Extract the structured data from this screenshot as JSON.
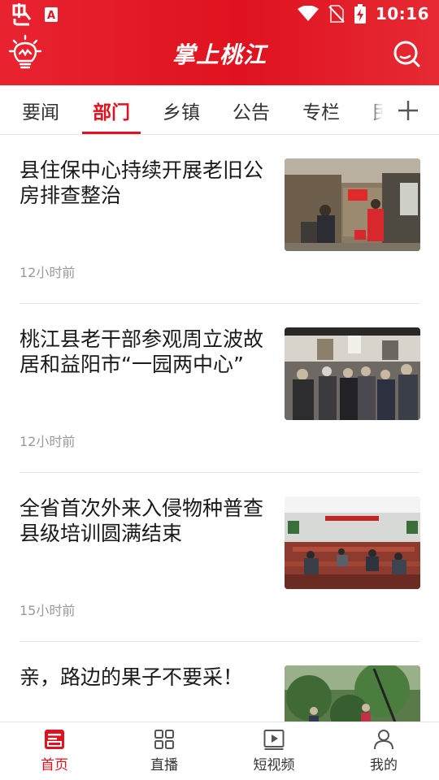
{
  "status_bar": {
    "time": "10:16"
  },
  "header": {
    "title": "掌上桃江",
    "left_icon": "lightbulb-icon",
    "right_icon": "search-icon"
  },
  "tabs": [
    {
      "label": "要闻",
      "active": false
    },
    {
      "label": "部门",
      "active": true
    },
    {
      "label": "乡镇",
      "active": false
    },
    {
      "label": "公告",
      "active": false
    },
    {
      "label": "专栏",
      "active": false
    },
    {
      "label": "民",
      "active": false
    }
  ],
  "add_tab_icon": "plus-icon",
  "news": [
    {
      "title": "县住保中心持续开展老旧公房排查整治",
      "time": "12小时前"
    },
    {
      "title": "桃江县老干部参观周立波故居和益阳市“一园两中心”",
      "time": "12小时前"
    },
    {
      "title": "全省首次外来入侵物种普查县级培训圆满结束",
      "time": "15小时前"
    },
    {
      "title": "亲，路边的果子不要采！",
      "time": ""
    }
  ],
  "bottom_nav": [
    {
      "label": "首页",
      "icon": "home-news-icon",
      "active": true
    },
    {
      "label": "直播",
      "icon": "grid-icon",
      "active": false
    },
    {
      "label": "短视频",
      "icon": "video-icon",
      "active": false
    },
    {
      "label": "我的",
      "icon": "user-icon",
      "active": false
    }
  ],
  "colors": {
    "brand_red": "#e0121f",
    "text": "#1a1a1a",
    "muted": "#999999"
  }
}
